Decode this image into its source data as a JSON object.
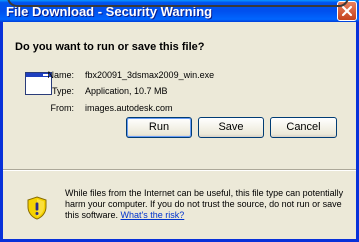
{
  "window": {
    "title": "File Download - Security Warning"
  },
  "dialog": {
    "question": "Do you want to run or save this file?",
    "file": {
      "name_label": "Name:",
      "name_value": "fbx20091_3dsmax2009_win.exe",
      "type_label": "Type:",
      "type_value": "Application, 10.7 MB",
      "from_label": "From:",
      "from_value": "images.autodesk.com"
    },
    "buttons": {
      "run": "Run",
      "save": "Save",
      "cancel": "Cancel"
    },
    "warning": {
      "text": "While files from the Internet can be useful, this file type can potentially harm your computer. If you do not trust the source, do not run or save this software. ",
      "link": "What's the risk?"
    }
  },
  "colors": {
    "titlebar": "#0054e3",
    "window_bg": "#ece9d8",
    "link": "#0033cc",
    "close_button": "#d5582e",
    "shield_yellow": "#f5d200"
  },
  "icons": [
    "application-file-icon",
    "close-icon",
    "security-shield-icon"
  ]
}
